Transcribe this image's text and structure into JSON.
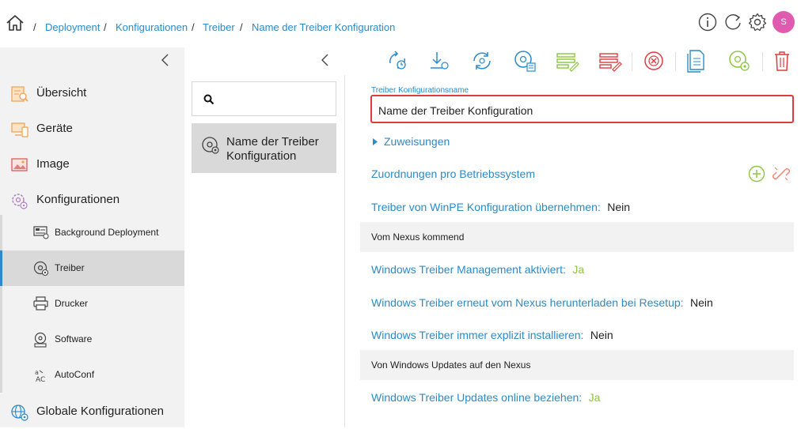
{
  "breadcrumb": {
    "items": [
      "Deployment",
      "Konfigurationen",
      "Treiber",
      "Name der Treiber Konfiguration"
    ],
    "separator": "/"
  },
  "header": {
    "icons": [
      "home-icon",
      "info-icon",
      "refresh-icon",
      "settings-gear-icon"
    ],
    "avatar_initial": "S",
    "avatar_color": "#e05aaf"
  },
  "sidebar": {
    "collapse_icon": "chevron-left-icon",
    "items": [
      {
        "label": "Übersicht",
        "icon": "overview-icon"
      },
      {
        "label": "Geräte",
        "icon": "devices-icon"
      },
      {
        "label": "Image",
        "icon": "image-icon"
      },
      {
        "label": "Konfigurationen",
        "icon": "configurations-icon"
      }
    ],
    "subitems": [
      {
        "label": "Background Deployment",
        "icon": "background-deployment-icon"
      },
      {
        "label": "Treiber",
        "icon": "driver-disc-icon",
        "selected": true
      },
      {
        "label": "Drucker",
        "icon": "printer-icon"
      },
      {
        "label": "Software",
        "icon": "software-icon"
      },
      {
        "label": "AutoConf",
        "icon": "autoconf-icon"
      }
    ],
    "bottom_item": {
      "label": "Globale Konfigurationen",
      "icon": "globe-gear-icon"
    }
  },
  "list": {
    "search_icon": "search-icon",
    "items": [
      {
        "label": "Name der Treiber Konfiguration",
        "icon": "driver-disc-icon"
      }
    ]
  },
  "toolbar": {
    "buttons": [
      "sync-clock-icon",
      "download-icon",
      "sync-refresh-icon",
      "disc-stack-icon",
      "list-edit-icon",
      "list-delete-icon",
      "cancel-circle-icon",
      "document-copy-icon",
      "disc-settings-icon",
      "trash-icon"
    ]
  },
  "detail": {
    "name_label": "Treiber Konfigurationsname",
    "name_value": "Name der Treiber Konfiguration",
    "zuweisungen": "Zuweisungen",
    "zuordnungen": "Zuordnungen pro Betriebssystem",
    "winpe_label": "Treiber von WinPE Konfiguration übernehmen:",
    "winpe_value": "Nein",
    "section_nexus": "Vom Nexus kommend",
    "wtm_label": "Windows Treiber Management aktiviert:",
    "wtm_value": "Ja",
    "redownload_label": "Windows Treiber erneut vom Nexus herunterladen bei Resetup:",
    "redownload_value": "Nein",
    "explicit_label": "Windows Treiber immer explizit installieren:",
    "explicit_value": "Nein",
    "section_wu": "Von Windows Updates auf den Nexus",
    "online_label": "Windows Treiber Updates online beziehen:",
    "online_value": "Ja"
  },
  "colors": {
    "link": "#2a8bc9",
    "accent_green": "#8cc63f",
    "accent_red": "#e0393e",
    "selected_bg": "#d9d9d9",
    "sidebar_bg": "#f2f2f2"
  }
}
